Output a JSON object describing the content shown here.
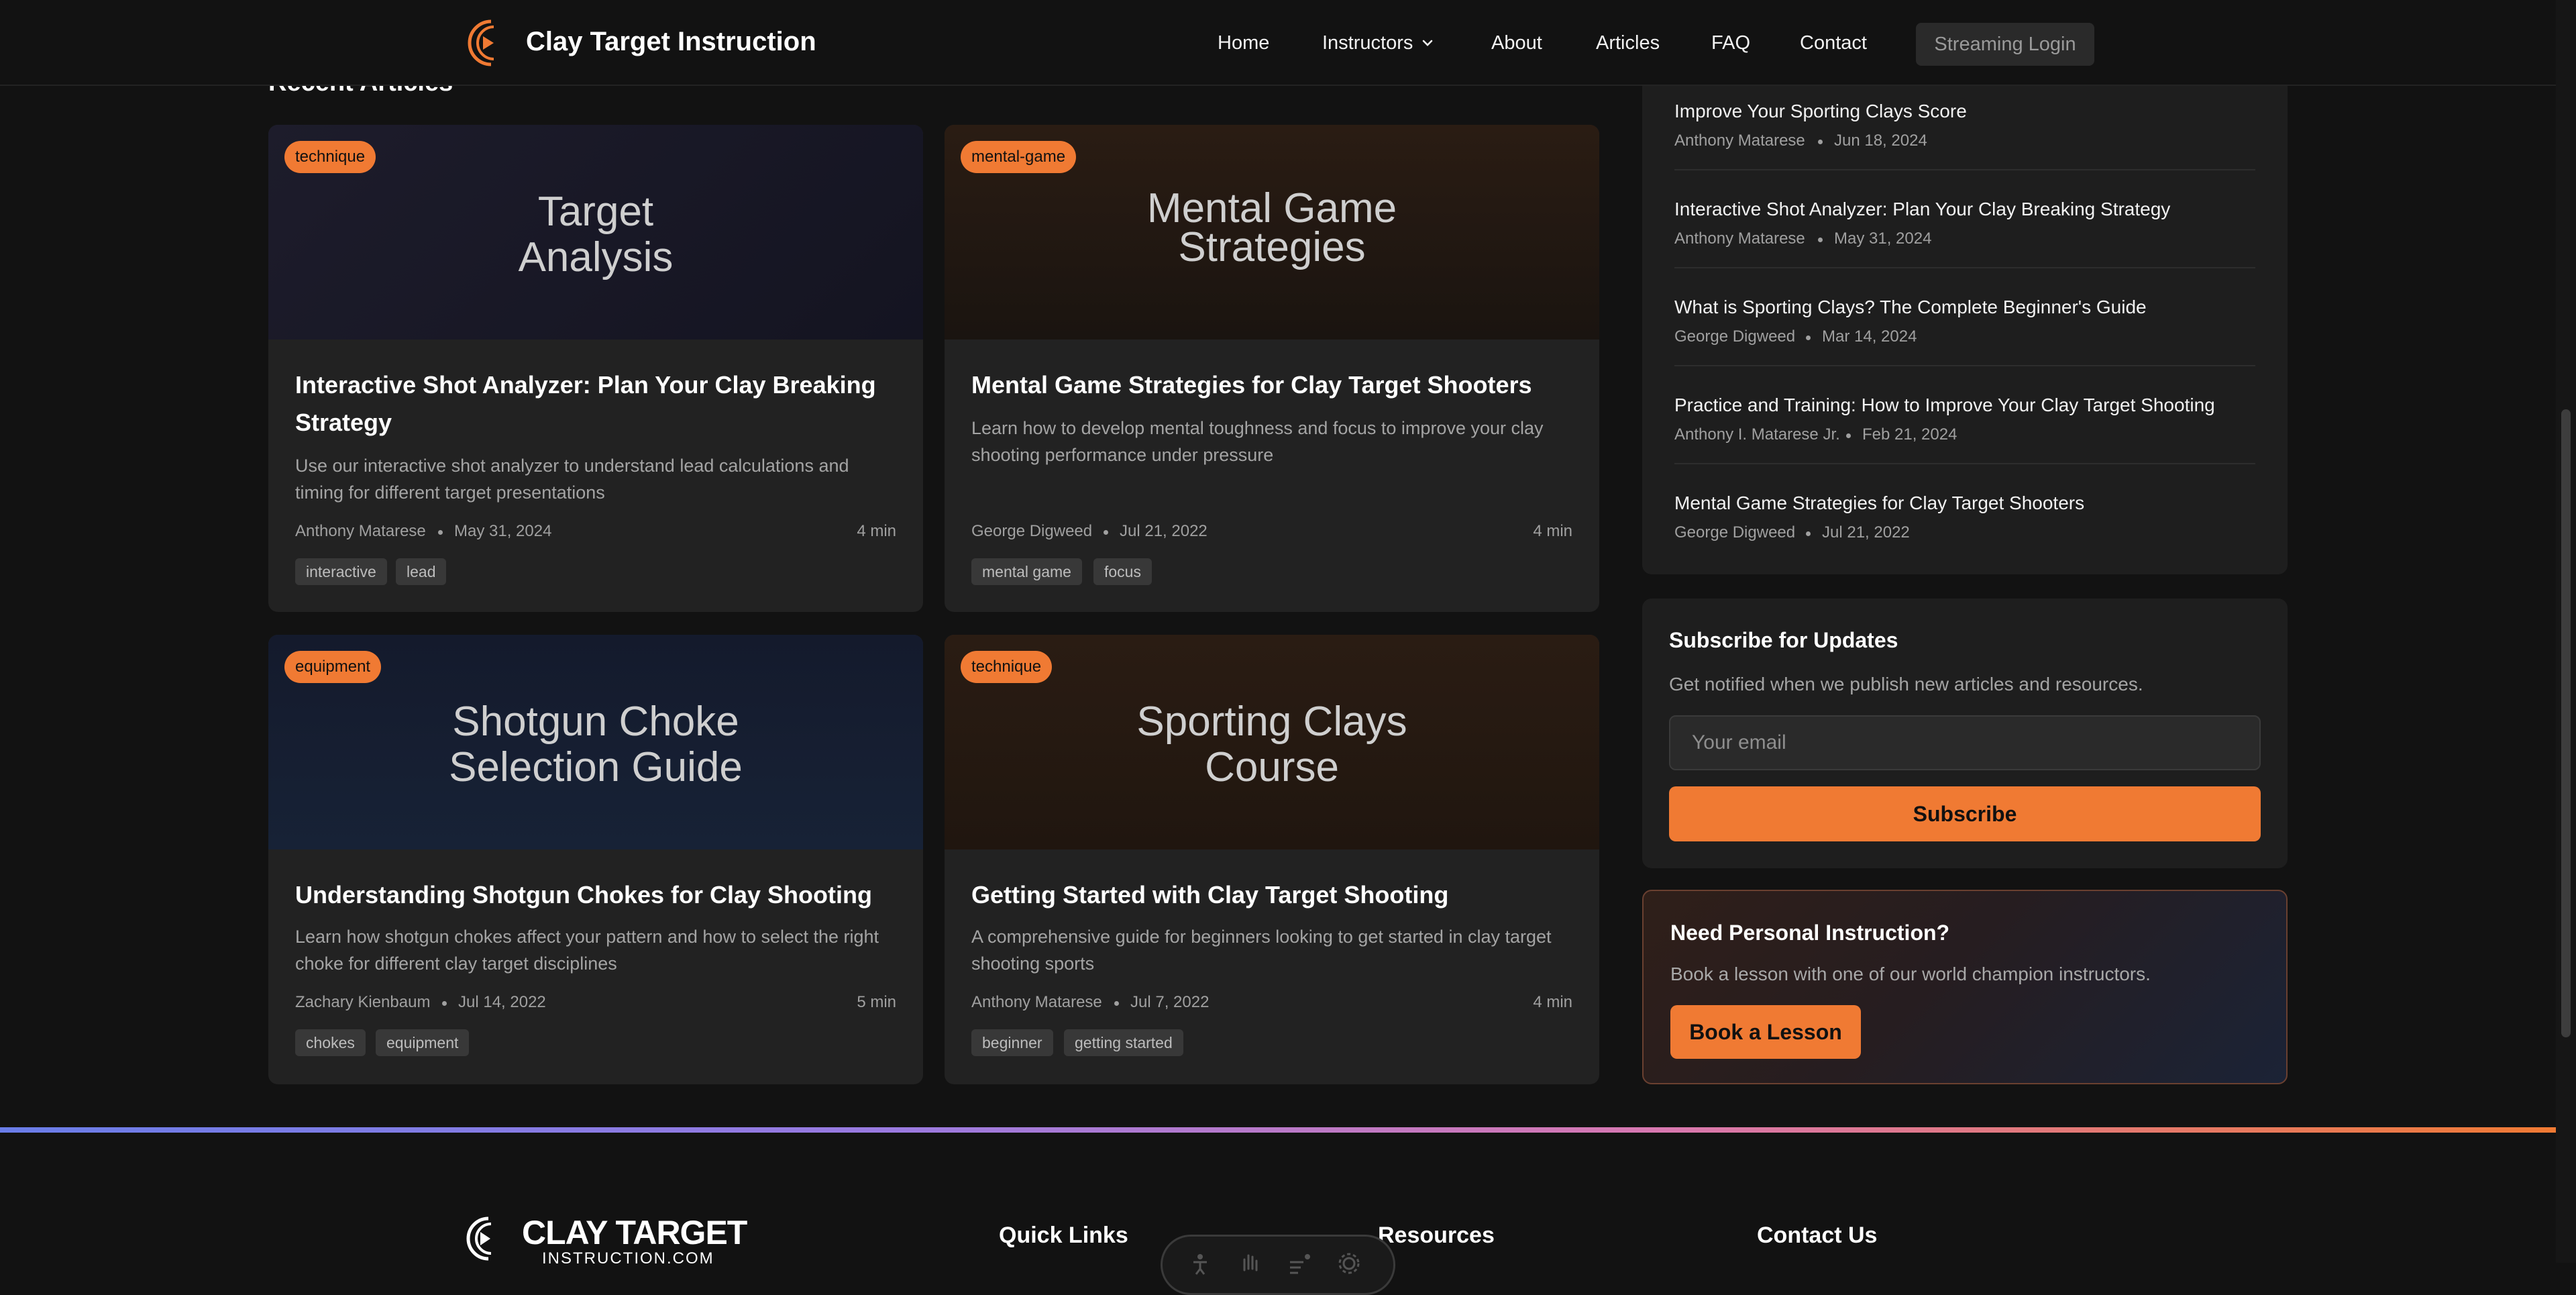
{
  "header": {
    "brand": "Clay Target Instruction",
    "nav": [
      "Home",
      "Instructors",
      "About",
      "Articles",
      "FAQ",
      "Contact"
    ],
    "streaming_login": "Streaming Login"
  },
  "main": {
    "section_title": "Recent Articles",
    "articles": [
      {
        "category": "technique",
        "banner": "Target\nAnalysis",
        "title": "Interactive Shot Analyzer: Plan Your Clay Breaking Strategy",
        "excerpt": "Use our interactive shot analyzer to understand lead calculations and timing for different target presentations",
        "author": "Anthony Matarese",
        "date": "May 31, 2024",
        "read": "4 min",
        "tags": [
          "interactive",
          "lead"
        ]
      },
      {
        "category": "mental-game",
        "banner": "Mental Game\nStrategies",
        "title": "Mental Game Strategies for Clay Target Shooters",
        "excerpt": "Learn how to develop mental toughness and focus to improve your clay shooting performance under pressure",
        "author": "George Digweed",
        "date": "Jul 21, 2022",
        "read": "4 min",
        "tags": [
          "mental game",
          "focus"
        ]
      },
      {
        "category": "equipment",
        "banner": "Shotgun Choke\nSelection Guide",
        "title": "Understanding Shotgun Chokes for Clay Shooting",
        "excerpt": "Learn how shotgun chokes affect your pattern and how to select the right choke for different clay target disciplines",
        "author": "Zachary Kienbaum",
        "date": "Jul 14, 2022",
        "read": "5 min",
        "tags": [
          "chokes",
          "equipment"
        ]
      },
      {
        "category": "technique",
        "banner": "Sporting Clays\nCourse",
        "title": "Getting Started with Clay Target Shooting",
        "excerpt": "A comprehensive guide for beginners looking to get started in clay target shooting sports",
        "author": "Anthony Matarese",
        "date": "Jul 7, 2022",
        "read": "4 min",
        "tags": [
          "beginner",
          "getting started"
        ]
      }
    ]
  },
  "sidebar": {
    "recent": [
      {
        "title": "Improve Your Sporting Clays Score",
        "author": "Anthony Matarese",
        "date": "Jun 18, 2024"
      },
      {
        "title": "Interactive Shot Analyzer: Plan Your Clay Breaking Strategy",
        "author": "Anthony Matarese",
        "date": "May 31, 2024"
      },
      {
        "title": "What is Sporting Clays? The Complete Beginner's Guide",
        "author": "George Digweed",
        "date": "Mar 14, 2024"
      },
      {
        "title": "Practice and Training: How to Improve Your Clay Target Shooting",
        "author": "Anthony I. Matarese Jr.",
        "date": "Feb 21, 2024"
      },
      {
        "title": "Mental Game Strategies for Clay Target Shooters",
        "author": "George Digweed",
        "date": "Jul 21, 2022"
      }
    ],
    "subscribe": {
      "title": "Subscribe for Updates",
      "text": "Get notified when we publish new articles and resources.",
      "placeholder": "Your email",
      "button": "Subscribe"
    },
    "instruction": {
      "title": "Need Personal Instruction?",
      "text": "Book a lesson with one of our world champion instructors.",
      "button": "Book a Lesson"
    }
  },
  "footer": {
    "brand": "CLAY TARGET",
    "brand_sub": "INSTRUCTION.COM",
    "headings": [
      "Quick Links",
      "Resources",
      "Contact Us"
    ]
  },
  "colors": {
    "accent": "#f07a33",
    "background": "#121212",
    "card": "#222222"
  }
}
